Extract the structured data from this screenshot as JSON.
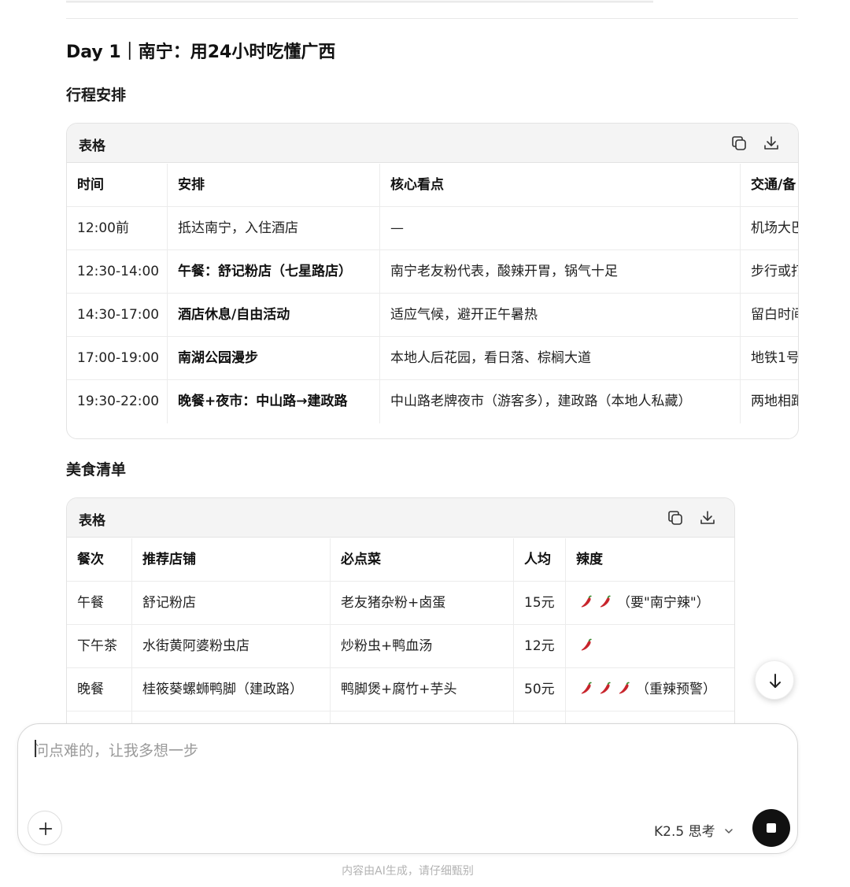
{
  "day_title": "Day 1｜南宁：用24小时吃懂广西",
  "schedule_heading": "行程安排",
  "food_heading": "美食清单",
  "schedule_table": {
    "label": "表格",
    "headers": [
      "时间",
      "安排",
      "核心看点",
      "交通/备"
    ],
    "rows": [
      [
        "12:00前",
        "抵达南宁，入住酒店",
        "—",
        "机场大巴"
      ],
      [
        "12:30-14:00",
        "午餐：舒记粉店（七星路店）",
        "南宁老友粉代表，酸辣开胃，锅气十足",
        "步行或打"
      ],
      [
        "14:30-17:00",
        "酒店休息/自由活动",
        "适应气候，避开正午暑热",
        "留白时间"
      ],
      [
        "17:00-19:00",
        "南湖公园漫步",
        "本地人后花园，看日落、棕榈大道",
        "地铁1号"
      ],
      [
        "19:30-22:00",
        "晚餐+夜市：中山路→建政路",
        "中山路老牌夜市（游客多），建政路（本地人私藏）",
        "两地相距"
      ]
    ]
  },
  "food_table": {
    "label": "表格",
    "headers": [
      "餐次",
      "推荐店铺",
      "必点菜",
      "人均",
      "辣度"
    ],
    "rows": [
      {
        "meal": "午餐",
        "shop": "舒记粉店",
        "dish": "老友猪杂粉+卤蛋",
        "price": "15元",
        "spice_level": 2,
        "spice_note": "（要\"南宁辣\"）"
      },
      {
        "meal": "下午茶",
        "shop": "水街黄阿婆粉虫店",
        "dish": "炒粉虫+鸭血汤",
        "price": "12元",
        "spice_level": 1,
        "spice_note": ""
      },
      {
        "meal": "晚餐",
        "shop": "桂筱葵螺蛳鸭脚（建政路）",
        "dish": "鸭脚煲+腐竹+芋头",
        "price": "50元",
        "spice_level": 3,
        "spice_note": "（重辣预警）"
      }
    ]
  },
  "composer": {
    "placeholder": "问点难的，让我多想一步",
    "model_label": "K2.5 思考"
  },
  "footer_note": "内容由AI生成，请仔细甄别",
  "icons": {
    "copy": "copy-icon",
    "download": "download-icon",
    "chili": "chili-pepper-icon",
    "scroll_down": "arrow-down-icon",
    "plus": "plus-icon",
    "chevron": "chevron-down-icon",
    "stop": "stop-icon"
  },
  "colors": {
    "chili_red": "#c8242b",
    "chili_stem": "#3a8a2e",
    "stop_button": "#111111"
  }
}
